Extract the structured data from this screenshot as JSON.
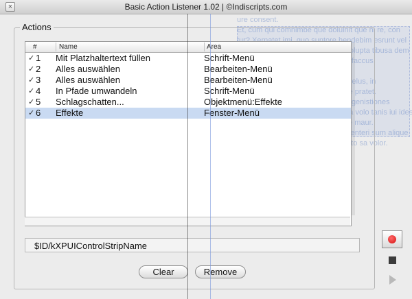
{
  "window": {
    "title": "Basic Action Listener 1.02  |  ©Indiscripts.com",
    "close_symbol": "×"
  },
  "background_text": [
    "ure consent.",
    "Et, cum qui comnimbe que doluinit que ni re, con",
    "tur? Xernatet imi, quo suntore hendebim esrunt vel",
    "eniane ciuori omnim, nis ea que volupta tibusa dem",
    "ereiata suiat qui velit que volorem faccus",
    "ecto nuliand asperum ellat oc",
    "ri imalinum sus nonsecto modute relus, in",
    "i moditibic isinti omnint volo cus ne pratet.",
    "e nonsequiss deruntibus quamnis genistiones",
    "audibil iui ecrbust te ma nonsequia volo tanis iui ides",
    "e es faccabusto es quodie sernore maur.",
    "a re vellatur sitas idos aut remare enteri sum alique",
    "mi delgendor magnis sime duciu sto sa volor."
  ],
  "actions_group": {
    "label": "Actions",
    "columns": {
      "num": "#",
      "name": "Name",
      "area": "Area"
    },
    "rows": [
      {
        "check": "✓",
        "num": "1",
        "name": "Mit Platzhaltertext füllen",
        "area": "Schrift-Menü",
        "selected": false
      },
      {
        "check": "✓",
        "num": "2",
        "name": "Alles auswählen",
        "area": "Bearbeiten-Menü",
        "selected": false
      },
      {
        "check": "✓",
        "num": "3",
        "name": "Alles auswählen",
        "area": "Bearbeiten-Menü",
        "selected": false
      },
      {
        "check": "✓",
        "num": "4",
        "name": "In Pfade umwandeln",
        "area": "Schrift-Menü",
        "selected": false
      },
      {
        "check": "✓",
        "num": "5",
        "name": "Schlagschatten...",
        "area": "Objektmenü:Effekte",
        "selected": false
      },
      {
        "check": "✓",
        "num": "6",
        "name": "Effekte",
        "area": "Fenster-Menü",
        "selected": true
      }
    ],
    "field_value": "$ID/kXPUIControlStripName"
  },
  "buttons": {
    "clear_label": "Clear",
    "remove_label": "Remove"
  },
  "side_controls": {
    "record_icon": "record-icon",
    "stop_icon": "stop-icon",
    "play_icon": "play-icon"
  },
  "colors": {
    "selection": "#c9daf2",
    "record": "#d61010"
  }
}
